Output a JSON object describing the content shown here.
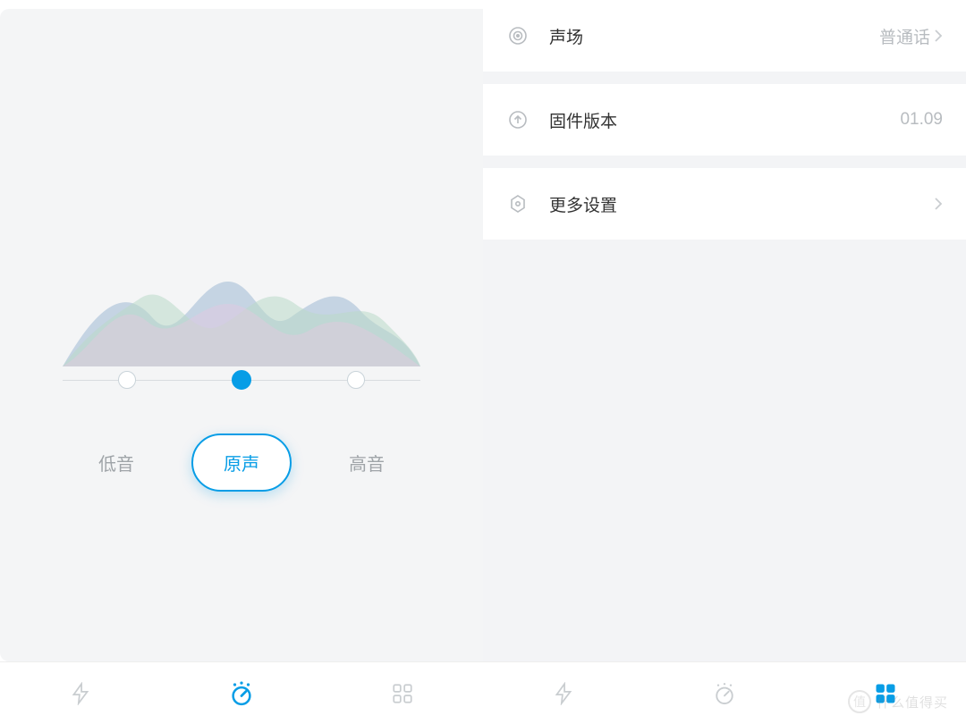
{
  "left": {
    "eq": {
      "bass": "低音",
      "original": "原声",
      "treble": "高音",
      "selected": 1
    },
    "tabs": {
      "active": 1
    }
  },
  "right": {
    "rows": [
      {
        "label": "声场",
        "value": "普通话",
        "chevron": true,
        "icon": "target"
      },
      {
        "label": "固件版本",
        "value": "01.09",
        "chevron": false,
        "icon": "arrow-up-circle"
      },
      {
        "label": "更多设置",
        "value": "",
        "chevron": true,
        "icon": "hex-gear"
      }
    ],
    "tabs": {
      "active": 2
    }
  },
  "watermark": {
    "char": "值",
    "text": "什么值得买"
  }
}
